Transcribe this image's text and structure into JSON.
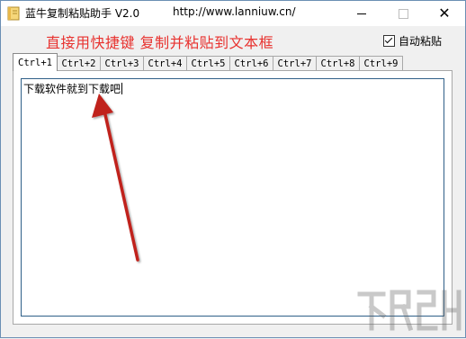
{
  "window": {
    "title": "蓝牛复制粘贴助手 V2.0",
    "url": "http://www.lanniuw.cn/"
  },
  "header": {
    "headline": "直接用快捷键  复制并粘贴到文本框",
    "autopaste_label": "自动粘贴",
    "autopaste_checked": true
  },
  "tabs": [
    {
      "label": "Ctrl+1",
      "active": true
    },
    {
      "label": "Ctrl+2",
      "active": false
    },
    {
      "label": "Ctrl+3",
      "active": false
    },
    {
      "label": "Ctrl+4",
      "active": false
    },
    {
      "label": "Ctrl+5",
      "active": false
    },
    {
      "label": "Ctrl+6",
      "active": false
    },
    {
      "label": "Ctrl+7",
      "active": false
    },
    {
      "label": "Ctrl+8",
      "active": false
    },
    {
      "label": "Ctrl+9",
      "active": false
    }
  ],
  "editor": {
    "content": "下载软件就到下载吧"
  },
  "colors": {
    "headline": "#e8322f",
    "arrow": "#c0201c",
    "border_accent": "#2f5f88"
  },
  "icons": {
    "app": "notebook-icon",
    "minimize": "minimize-icon",
    "maximize": "maximize-icon",
    "close": "close-icon",
    "annotation": "red-arrow",
    "watermark": "site-logo"
  }
}
